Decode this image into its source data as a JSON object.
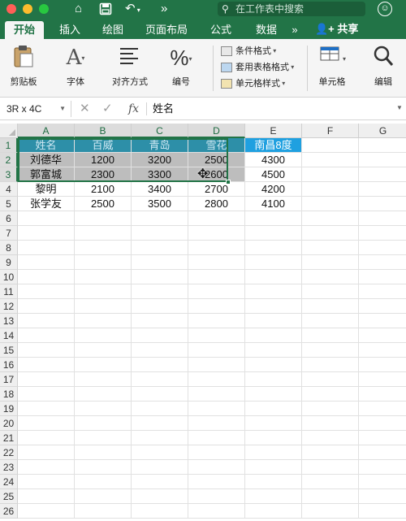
{
  "titlebar": {
    "search_placeholder": "在工作表中搜索",
    "icons": [
      "home-icon",
      "save-icon",
      "undo-icon",
      "more-icon",
      "search-icon",
      "user-icon"
    ]
  },
  "ribbon": {
    "tabs": [
      "开始",
      "插入",
      "绘图",
      "页面布局",
      "公式",
      "数据"
    ],
    "active_tab": "开始",
    "tabs_overflow": "»",
    "share_label": "共享",
    "groups": {
      "clipboard": "剪贴板",
      "font": "字体",
      "align": "对齐方式",
      "number": "编号",
      "cells": "单元格",
      "edit": "编辑"
    },
    "styles": {
      "conditional": "条件格式",
      "table_format": "套用表格格式",
      "cell_styles": "单元格样式"
    }
  },
  "formula_bar": {
    "name_box": "3R x 4C",
    "fx": "fx",
    "value": "姓名"
  },
  "grid": {
    "columns": [
      "A",
      "B",
      "C",
      "D",
      "E",
      "F",
      "G"
    ],
    "row_numbers": [
      "1",
      "2",
      "3",
      "4",
      "5",
      "6",
      "7",
      "8",
      "9",
      "10",
      "11",
      "12",
      "13",
      "14",
      "15",
      "16",
      "17",
      "18",
      "19",
      "20",
      "21",
      "22",
      "23",
      "24",
      "25",
      "26"
    ],
    "header_row": [
      "姓名",
      "百威",
      "青岛",
      "雪花",
      "南昌8度"
    ],
    "rows": [
      [
        "刘德华",
        "1200",
        "3200",
        "2500",
        "4300"
      ],
      [
        "郭富城",
        "2300",
        "3300",
        "2600",
        "4500"
      ],
      [
        "黎明",
        "2100",
        "3400",
        "2700",
        "4200"
      ],
      [
        "张学友",
        "2500",
        "3500",
        "2800",
        "4100"
      ]
    ],
    "selection": "A1:D3"
  },
  "colors": {
    "accent": "#227447",
    "header_fill": "#1fa0e0",
    "selection_fill": "#bdbdbd"
  }
}
